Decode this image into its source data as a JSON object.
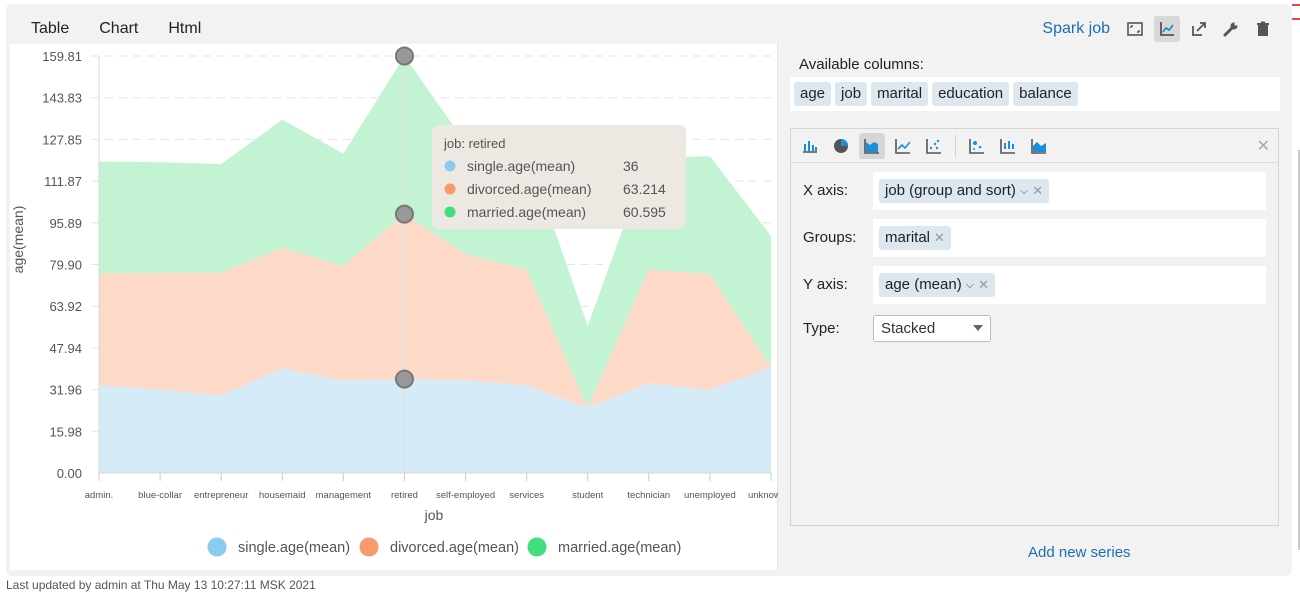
{
  "tabs": [
    {
      "label": "Table",
      "active": false
    },
    {
      "label": "Chart",
      "active": true
    },
    {
      "label": "Html",
      "active": false
    }
  ],
  "toolbar": {
    "spark_job_label": "Spark job",
    "buttons": [
      {
        "icon": "fullscreen-icon",
        "active": false
      },
      {
        "icon": "chart-settings-icon",
        "active": true
      },
      {
        "icon": "export-icon",
        "active": false
      },
      {
        "icon": "wrench-icon",
        "active": false
      },
      {
        "icon": "trash-icon",
        "active": false
      }
    ]
  },
  "available_columns": {
    "label": "Available columns:",
    "columns": [
      "age",
      "job",
      "marital",
      "education",
      "balance"
    ]
  },
  "series_editor": {
    "chart_types": [
      "bar-chart-icon",
      "pie-chart-icon",
      "area-chart-icon",
      "line-chart-icon",
      "scatter-chart-icon",
      "bubble-chart-icon",
      "box-chart-icon",
      "area-line-chart-icon"
    ],
    "active_chart_type": "area-chart-icon",
    "x_axis": {
      "label": "X axis:",
      "value": "job (group and sort)"
    },
    "groups": {
      "label": "Groups:",
      "value": "marital"
    },
    "y_axis": {
      "label": "Y axis:",
      "value": "age (mean)"
    },
    "type": {
      "label": "Type:",
      "value": "Stacked"
    }
  },
  "add_series_label": "Add new series",
  "status_text": "Last updated by admin at Thu May 13 10:27:11 MSK 2021",
  "colors": {
    "single": "#8ccbee",
    "divorced": "#f99a6d",
    "married": "#42de7e",
    "link": "#1a6fb3"
  },
  "chart_data": {
    "type": "area",
    "stacked": true,
    "xlabel": "job",
    "ylabel": "age(mean)",
    "ylim": [
      0,
      159.81
    ],
    "yticks": [
      "0.00",
      "15.98",
      "31.96",
      "47.94",
      "63.92",
      "79.90",
      "95.89",
      "111.87",
      "127.85",
      "143.83",
      "159.81"
    ],
    "grid": true,
    "legend_position": "bottom",
    "categories": [
      "admin.",
      "blue-collar",
      "entrepreneur",
      "housemaid",
      "management",
      "retired",
      "self-employed",
      "services",
      "student",
      "technician",
      "unemployed",
      "unknown"
    ],
    "series": [
      {
        "name": "single.age(mean)",
        "values": [
          33.6,
          32.0,
          29.8,
          40.0,
          35.5,
          36,
          35.5,
          33.6,
          25.1,
          34.5,
          31.7,
          40.6
        ]
      },
      {
        "name": "divorced.age(mean)",
        "values": [
          42.9,
          44.7,
          47.0,
          46.4,
          43.9,
          63.214,
          48.4,
          44.5,
          0.0,
          43.6,
          44.5,
          0.0
        ]
      },
      {
        "name": "married.age(mean)",
        "values": [
          42.9,
          42.4,
          41.6,
          49.0,
          43.0,
          60.595,
          42.5,
          45.9,
          31.3,
          42.9,
          45.2,
          50.2
        ]
      }
    ],
    "tooltip": {
      "title": "job: retired",
      "category_index": 5,
      "rows": [
        {
          "name": "single.age(mean)",
          "value": "36"
        },
        {
          "name": "divorced.age(mean)",
          "value": "63.214"
        },
        {
          "name": "married.age(mean)",
          "value": "60.595"
        }
      ]
    }
  }
}
